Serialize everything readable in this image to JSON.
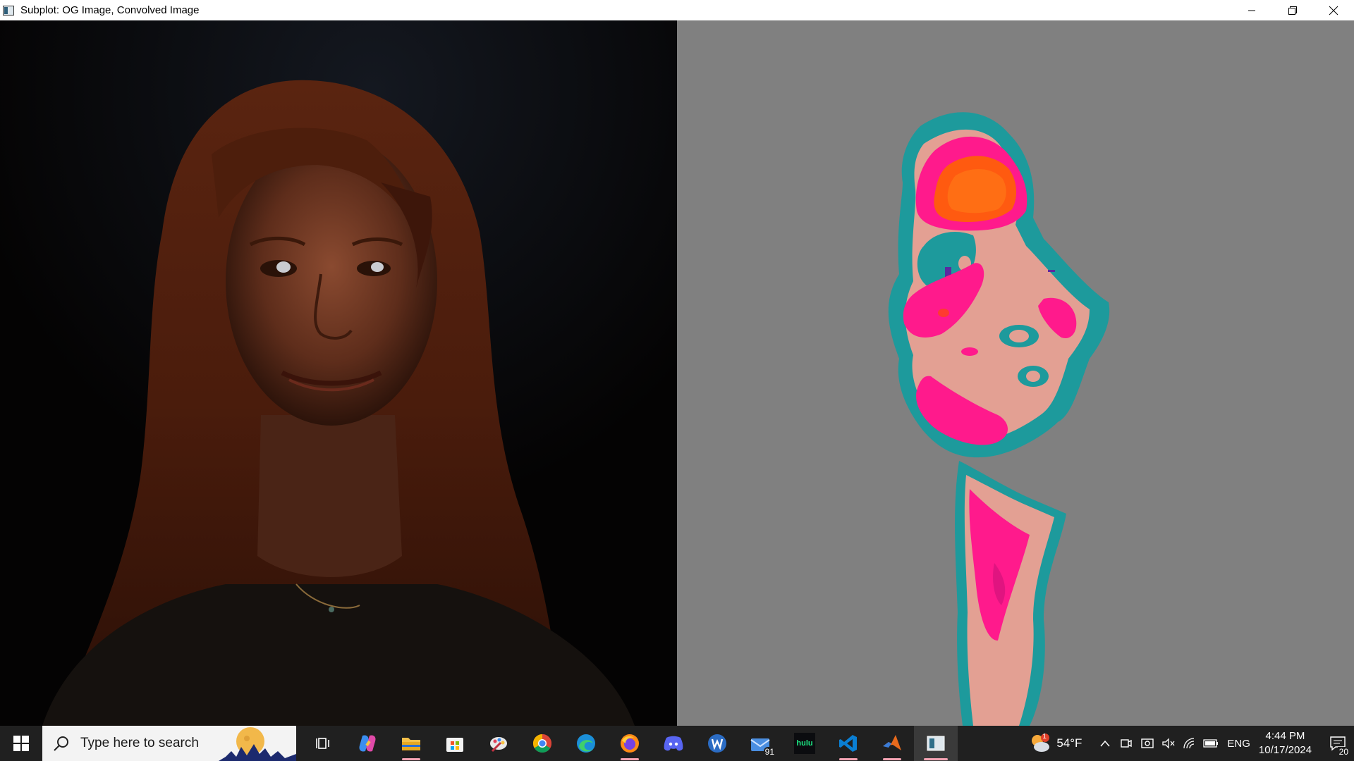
{
  "window": {
    "title": "Subplot: OG Image, Convolved Image"
  },
  "taskbar": {
    "search_placeholder": "Type here to search",
    "pinned": [
      {
        "name": "task-view"
      },
      {
        "name": "copilot"
      },
      {
        "name": "file-explorer"
      },
      {
        "name": "microsoft-store"
      },
      {
        "name": "paint-app"
      },
      {
        "name": "chrome"
      },
      {
        "name": "edge"
      },
      {
        "name": "firefox"
      },
      {
        "name": "discord"
      },
      {
        "name": "word-app"
      },
      {
        "name": "mail"
      },
      {
        "name": "hulu"
      },
      {
        "name": "vscode"
      },
      {
        "name": "matlab"
      },
      {
        "name": "image-viewer"
      }
    ],
    "mail_badge": "91",
    "hulu_label": "hulu",
    "weather_temp": "54°F",
    "weather_alert": "1",
    "language": "ENG",
    "time": "4:44 PM",
    "date": "10/17/2024",
    "notification_count": "20"
  },
  "colors": {
    "heat_gray": "#808080",
    "heat_teal": "#1d9a9c",
    "heat_pink": "#ff1a8c",
    "heat_salmon": "#e8a096",
    "heat_orange": "#ff5a10",
    "taskbar": "#202020"
  }
}
